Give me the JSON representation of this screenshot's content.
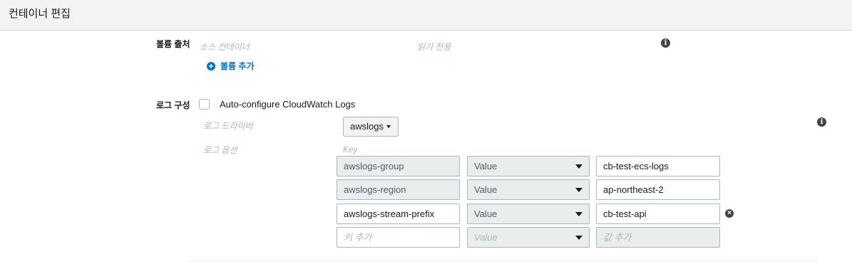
{
  "header": {
    "title": "컨테이너 편집"
  },
  "volumes": {
    "label": "볼륨 출처",
    "col_source": "소스 컨테이너",
    "col_readonly": "읽기 전용",
    "add_label": "볼륨 추가"
  },
  "logging": {
    "label": "로그 구성",
    "autoconfigure_label": "Auto-configure CloudWatch Logs",
    "autoconfigure_checked": false,
    "driver_label": "로그 드라이버",
    "driver_value": "awslogs",
    "options_label": "로그 옵션",
    "key_header": "Key",
    "options": [
      {
        "key": "awslogs-group",
        "type": "Value",
        "value": "cb-test-ecs-logs"
      },
      {
        "key": "awslogs-region",
        "type": "Value",
        "value": "ap-northeast-2"
      },
      {
        "key": "awslogs-stream-prefix",
        "type": "Value",
        "value": "cb-test-api"
      }
    ],
    "new_option": {
      "key_placeholder": "키 추가",
      "type_placeholder": "Value",
      "value_placeholder": "값 추가"
    }
  },
  "icons": {
    "info": "info-icon",
    "add": "plus-circle-icon",
    "remove": "remove-circle-icon"
  },
  "colors": {
    "link": "#0073bb",
    "header_bg": "#f2f3f3",
    "disabled_bg": "#eaeded"
  }
}
